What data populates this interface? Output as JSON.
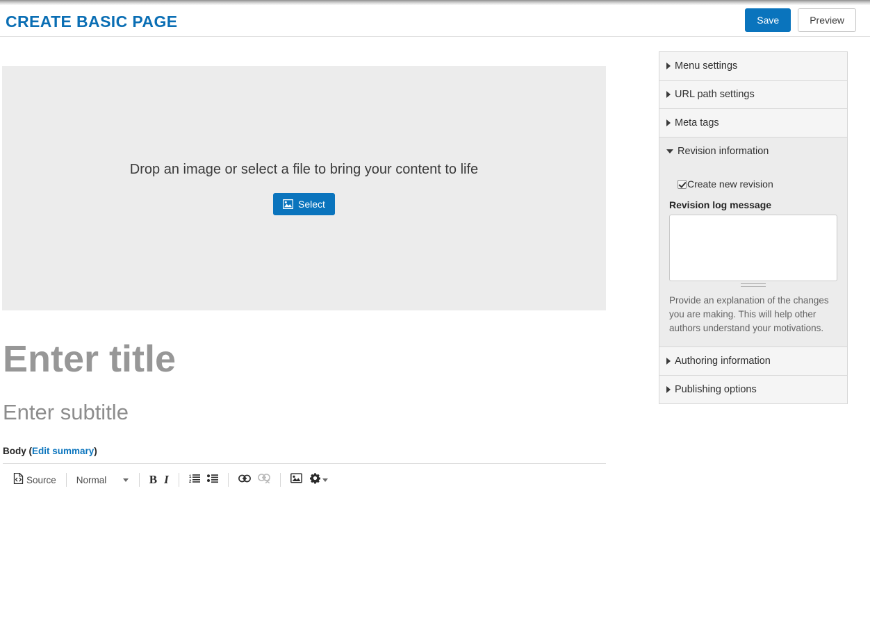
{
  "header": {
    "title": "Create basic page",
    "save_label": "Save",
    "preview_label": "Preview"
  },
  "hero": {
    "drop_text": "Drop an image or select a file to bring your content to life",
    "select_label": "Select",
    "select_icon": "image-icon"
  },
  "fields": {
    "title_placeholder": "Enter title",
    "subtitle_placeholder": "Enter subtitle",
    "body_label": "Body",
    "body_open_paren": "(",
    "body_edit_summary": "Edit summary",
    "body_close_paren": ")"
  },
  "editor_toolbar": {
    "source_label": "Source",
    "source_icon": "source-code-icon",
    "format_value": "Normal",
    "bold_label": "B",
    "italic_label": "I",
    "numbered_list_icon": "numbered-list-icon",
    "bulleted_list_icon": "bulleted-list-icon",
    "link_icon": "link-icon",
    "unlink_icon": "unlink-icon",
    "image_icon": "image-icon",
    "settings_icon": "gear-icon"
  },
  "sidebar": {
    "panels": [
      {
        "label": "Menu settings",
        "expanded": false
      },
      {
        "label": "URL path settings",
        "expanded": false
      },
      {
        "label": "Meta tags",
        "expanded": false
      },
      {
        "label": "Revision information",
        "expanded": true
      },
      {
        "label": "Authoring information",
        "expanded": false
      },
      {
        "label": "Publishing options",
        "expanded": false
      }
    ],
    "revision": {
      "create_new_revision_label": "Create new revision",
      "create_new_revision_checked": true,
      "log_message_label": "Revision log message",
      "log_message_value": "",
      "description": "Provide an explanation of the changes you are making. This will help other authors understand your motivations."
    }
  },
  "colors": {
    "brand_blue": "#0a74bd",
    "title_blue": "#0a6eb4",
    "dropzone_bg": "#ececec",
    "panel_bg": "#f5f5f5",
    "panel_open_bg": "#ececec"
  }
}
